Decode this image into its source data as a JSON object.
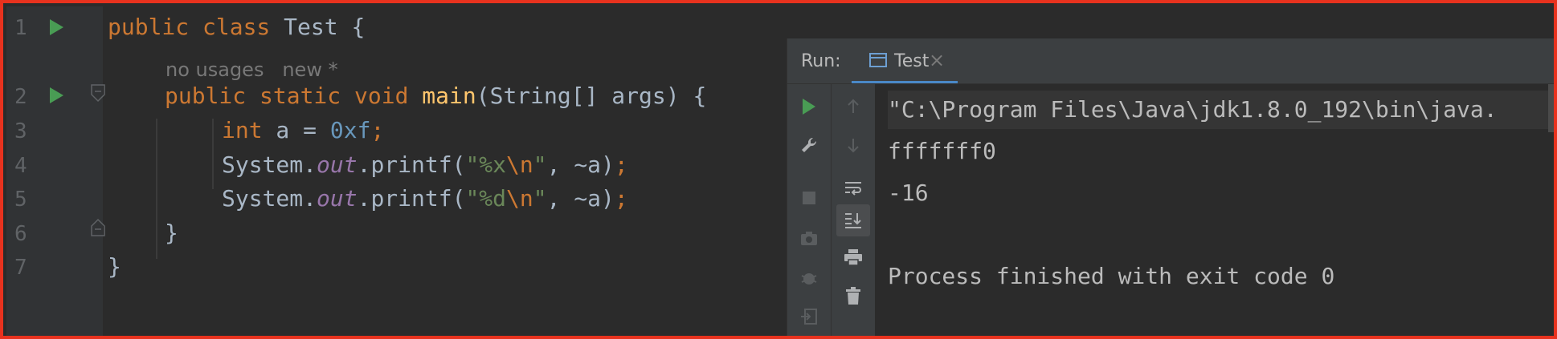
{
  "editor": {
    "line_numbers": [
      "1",
      "2",
      "3",
      "4",
      "5",
      "6",
      "7"
    ],
    "hint": {
      "usages": "no usages",
      "author": "new *"
    },
    "lines": {
      "l1": {
        "kw": "public class",
        "text": " Test {"
      },
      "l2": {
        "kw": "public static void",
        "fn": "main",
        "text": "(String[] args) {"
      },
      "l3": {
        "kw": "int",
        "var": " a = ",
        "num": "0xf",
        "semi": ";"
      },
      "l4": {
        "obj": "System.",
        "fld": "out",
        "call": ".printf(",
        "str_open": "\"%x",
        "esc": "\\n",
        "str_close": "\"",
        "rest": ", ~a)",
        "semi": ";"
      },
      "l5": {
        "obj": "System.",
        "fld": "out",
        "call": ".printf(",
        "str_open": "\"%d",
        "esc": "\\n",
        "str_close": "\"",
        "rest": ", ~a)",
        "semi": ";"
      },
      "l6": {
        "text": "}"
      },
      "l7": {
        "text": "}"
      }
    }
  },
  "run_panel": {
    "label": "Run:",
    "tab_label": "Test",
    "tab_close": "×",
    "console_lines": [
      "\"C:\\Program Files\\Java\\jdk1.8.0_192\\bin\\java.",
      "fffffff0",
      "-16",
      "",
      "Process finished with exit code 0"
    ]
  },
  "colors": {
    "frame_border": "#e8321e",
    "keyword": "#cc7832",
    "function": "#ffc66d",
    "field": "#9876aa",
    "number": "#6897bb",
    "string": "#6a8759",
    "run_green": "#499c54"
  }
}
